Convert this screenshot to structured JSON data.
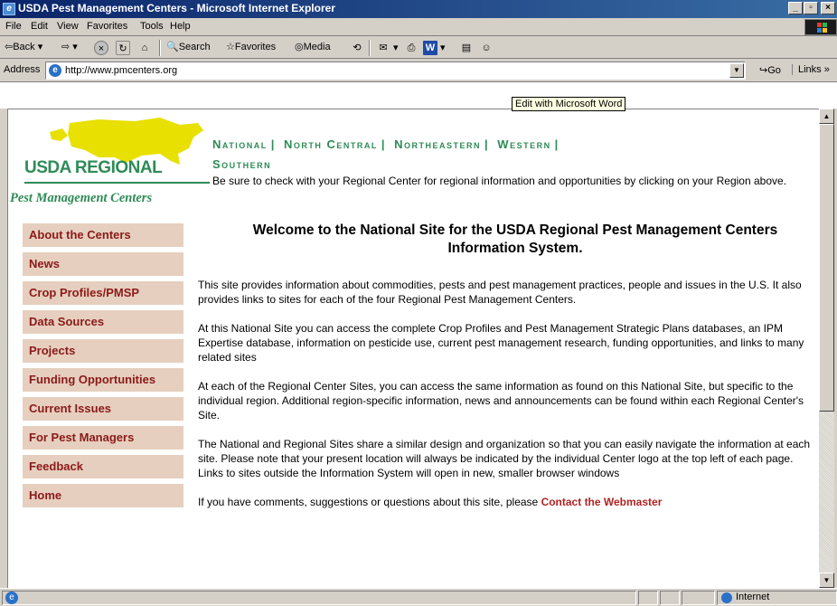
{
  "window": {
    "title": "USDA Pest Management Centers - Microsoft Internet Explorer",
    "buttons": {
      "minimize": "_",
      "maximize": "▫",
      "close": "×"
    }
  },
  "menu": [
    "File",
    "Edit",
    "View",
    "Favorites",
    "Tools",
    "Help"
  ],
  "toolbar": {
    "back": "Back",
    "search": "Search",
    "favorites": "Favorites",
    "media": "Media"
  },
  "address": {
    "label": "Address",
    "url": "http://www.pmcenters.org",
    "go": "Go",
    "links": "Links"
  },
  "tooltip": "Edit with Microsoft Word",
  "page": {
    "logo": {
      "line1": "USDA REGIONAL",
      "line2": "Pest Management Centers"
    },
    "regions": [
      "National",
      "North Central",
      "Northeastern",
      "Western",
      "Southern"
    ],
    "region_note": "Be sure to check with your Regional Center for regional information and opportunities by clicking on your Region above.",
    "nav": [
      "About the Centers",
      "News",
      "Crop Profiles/PMSP",
      "Data Sources",
      "Projects",
      "Funding Opportunities",
      "Current Issues",
      "For Pest Managers",
      "Feedback",
      "Home"
    ],
    "heading": "Welcome to the National Site for the USDA Regional Pest Management Centers Information System.",
    "paragraphs": [
      "This site provides information about commodities, pests and pest management practices, people and issues in the U.S. It also provides links to sites for each of the four Regional Pest Management Centers.",
      "At this National Site you can access the complete Crop Profiles and Pest Management Strategic Plans databases, an IPM Expertise database, information on pesticide use, current pest management research, funding opportunities, and links to many related sites",
      "At each of the Regional Center Sites, you can access the same information as found on this National Site, but specific to the individual region. Additional region-specific information, news and announcements can be found within each Regional Center's Site.",
      "The National and Regional Sites share a similar design and organization so that you can easily navigate the information at each site. Please note that your present location will always be indicated by the individual Center logo at the top left of each page. Links to sites outside the Information System will open in new, smaller browser windows"
    ],
    "cut_text": "If you have comments, suggestions or questions about this site, please",
    "cut_link": "Contact the Webmaster"
  },
  "status": {
    "zone": "Internet"
  },
  "colors": {
    "green": "#2e8b57",
    "nav_bg": "#e6cfbe",
    "nav_text": "#8b1a1a",
    "title_bar": "#0a246a"
  }
}
